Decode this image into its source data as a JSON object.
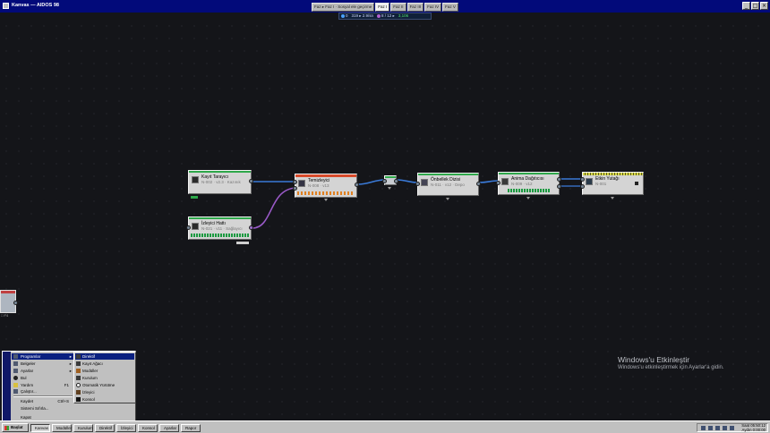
{
  "window": {
    "title": "Kanvas — AIDOS 98",
    "controls": [
      "_",
      "□",
      "×"
    ]
  },
  "phase_tabs": [
    {
      "label": "Faz ▸ Faz I · Sosyal ele geçirme",
      "active": false
    },
    {
      "label": "Faz I",
      "active": true
    },
    {
      "label": "Faz II",
      "active": false
    },
    {
      "label": "Faz III",
      "active": false
    },
    {
      "label": "Faz IV",
      "active": false
    },
    {
      "label": "Faz V",
      "active": false
    }
  ],
  "status_strip": {
    "a": "0",
    "b": "319 ▸ 2.9/sn",
    "c": "8 / 12 ▸",
    "d": "3,106"
  },
  "nodes": [
    {
      "id": "kayit",
      "title": "Kayıt Tarayıcı",
      "sub": "N-002 · v2.3 · Kazınık",
      "header_color": "#2ea84a"
    },
    {
      "id": "izleyici",
      "title": "İzleyici Hattı",
      "sub": "N-021 · v11 · Sağlayıcı",
      "header_color": "#2ea84a"
    },
    {
      "id": "temizleyici",
      "title": "Temizleyici",
      "sub": "N-008 · v13",
      "header_color": "#d84a2a"
    },
    {
      "id": "gecit",
      "title": "",
      "sub": "",
      "header_color": "#2ea84a"
    },
    {
      "id": "onbellek",
      "title": "Önbellek Dizisi",
      "sub": "N-011 · v12 · Depo",
      "header_color": "#2ea84a"
    },
    {
      "id": "anima",
      "title": "Anima Dağıtıcısı",
      "sub": "N-009 · v12",
      "header_color": "#2ea84a"
    },
    {
      "id": "etkin",
      "title": "Etkin Yutağı",
      "sub": "N-001",
      "header_color": "#d8d84a"
    }
  ],
  "side_node": {
    "label": "□ F4"
  },
  "start_menu": {
    "items": [
      {
        "label": "Programlar",
        "arrow": "▸",
        "highlighted": true
      },
      {
        "label": "Belgeler",
        "arrow": "▸"
      },
      {
        "label": "Ayarlar",
        "arrow": "▸"
      },
      {
        "label": "Bul",
        "arrow": ""
      },
      {
        "label": "Yardım",
        "key": "F1"
      },
      {
        "label": "Çalıştır...",
        "key": ""
      },
      {
        "label": "Kaydet",
        "key": "Ctrl+S"
      },
      {
        "label": "Sistemi Sıfırla...",
        "key": ""
      },
      {
        "label": "Kapat",
        "key": ""
      }
    ],
    "submenu": [
      {
        "label": "Direktif",
        "highlighted": true
      },
      {
        "label": "Kayıt Ağacı"
      },
      {
        "label": "Modüller"
      },
      {
        "label": "Kurulum"
      },
      {
        "label": "Otomatik Yürütme"
      },
      {
        "label": "İzleyici"
      },
      {
        "label": "Konsol"
      }
    ]
  },
  "watermark": {
    "title": "Windows'u Etkinleştir",
    "subtitle": "Windows'u etkinleştirmek için Ayarlar'a gidin."
  },
  "taskbar": {
    "start_label": "Başlat",
    "buttons": [
      {
        "label": "Kanvas",
        "active": true
      },
      {
        "label": "Modüller"
      },
      {
        "label": "Kurulum"
      },
      {
        "label": "Direktif"
      },
      {
        "label": "İzleyici"
      },
      {
        "label": "Konsol"
      },
      {
        "label": "Ayarlar"
      },
      {
        "label": "Rapor"
      }
    ],
    "clock_line1": "Saat 05:50:12",
    "clock_line2": "Aydın 0:00:00"
  }
}
